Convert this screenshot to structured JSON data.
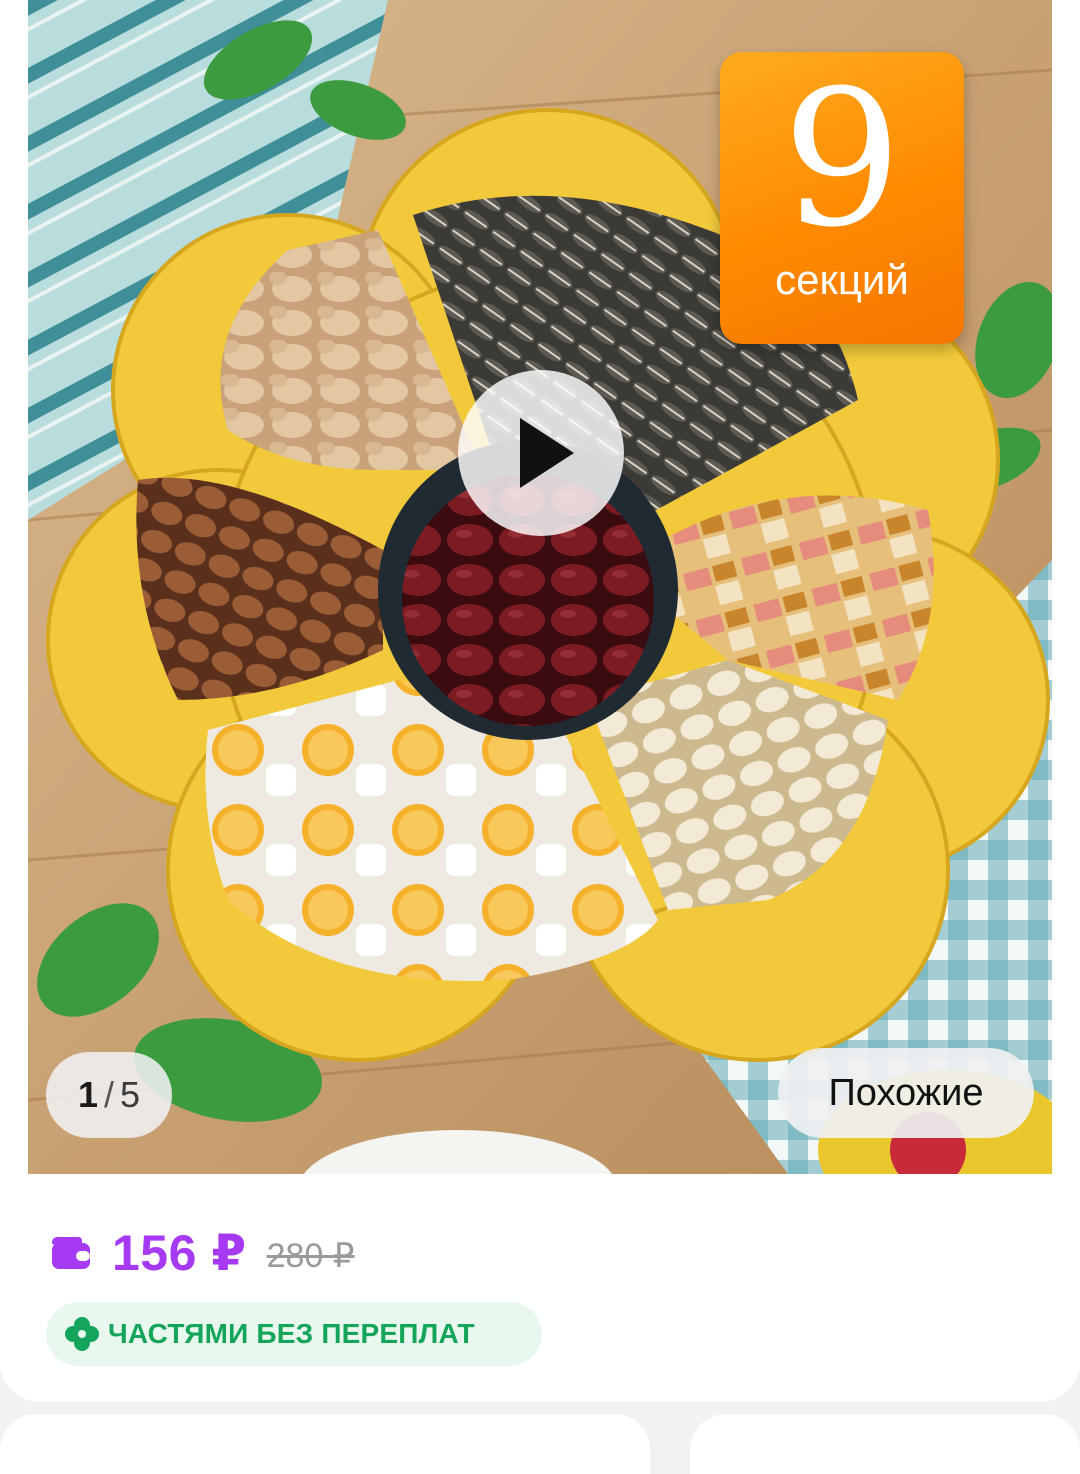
{
  "product": {
    "badge": {
      "number": "9",
      "unit": "секций"
    },
    "gallery": {
      "current": "1",
      "separator": "/",
      "total": "5"
    },
    "similar_button": "Похожие",
    "price": {
      "current": "156 ₽",
      "old": "280 ₽"
    },
    "installments": {
      "label": "ЧАСТЯМИ БЕЗ ПЕРЕПЛАТ"
    }
  },
  "colors": {
    "price_accent": "#a53af2",
    "installments_text": "#14a55b",
    "installments_bg": "#e8f8ee",
    "badge_orange": "#ff8a00"
  },
  "icons": {
    "wallet": "wallet-icon",
    "clover": "clover-icon",
    "play": "play-icon"
  }
}
